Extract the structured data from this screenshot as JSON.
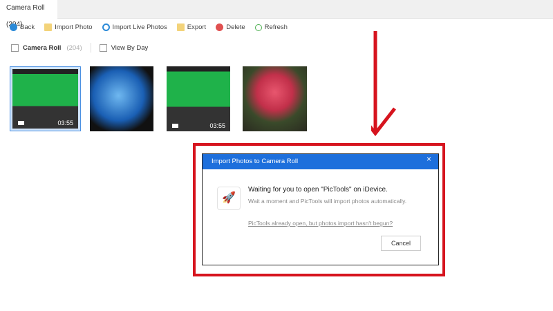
{
  "tab": {
    "label": "Camera Roll (204)"
  },
  "toolbar": {
    "back": "Back",
    "import_photo": "Import Photo",
    "import_live": "Import Live Photos",
    "export": "Export",
    "delete": "Delete",
    "refresh": "Refresh"
  },
  "filter": {
    "camera_roll": "Camera Roll",
    "count": "(204)",
    "view_by_day": "View By Day"
  },
  "thumbnails": [
    {
      "type": "video",
      "duration": "03:55",
      "selected": true
    },
    {
      "type": "photo"
    },
    {
      "type": "video",
      "duration": "03:55"
    },
    {
      "type": "photo"
    }
  ],
  "dialog": {
    "title": "Import Photos to Camera Roll",
    "close": "×",
    "heading": "Waiting for you to open \"PicTools\" on iDevice.",
    "subtext": "Wait a moment and PicTools will import photos automatically.",
    "link": "PicTools already open, but photos import hasn't begun?",
    "cancel": "Cancel",
    "icon": "rocket-icon"
  },
  "colors": {
    "accent": "#1d6fdc",
    "annotation": "#d6141e"
  }
}
